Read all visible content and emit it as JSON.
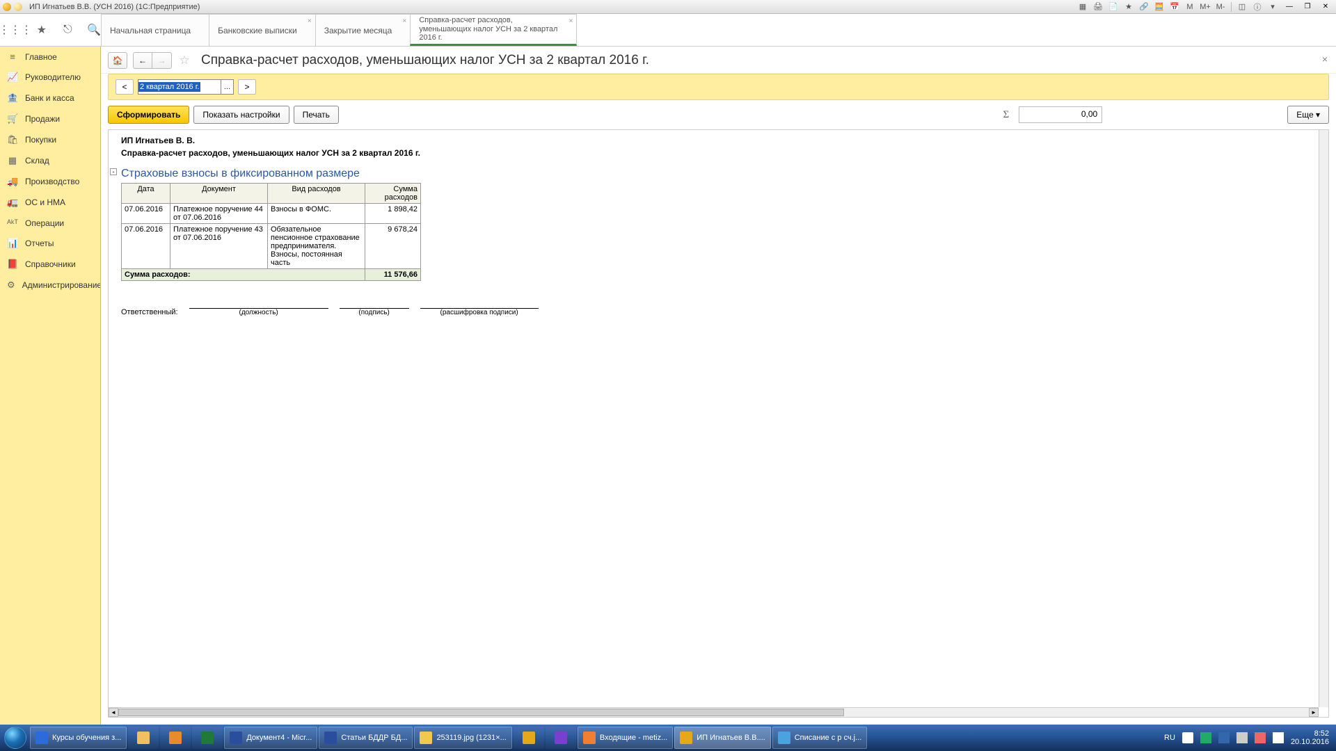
{
  "titlebar": {
    "title": "ИП Игнатьев В.В. (УСН 2016)  (1С:Предприятие)",
    "m_labels": [
      "M",
      "M+",
      "M-"
    ]
  },
  "tabs": [
    {
      "label": "Начальная страница"
    },
    {
      "label": "Банковские выписки"
    },
    {
      "label": "Закрытие месяца"
    },
    {
      "label": "Справка-расчет расходов, уменьшающих налог УСН  за 2 квартал 2016 г.",
      "active": true
    }
  ],
  "sidebar": {
    "items": [
      {
        "icon": "≡",
        "label": "Главное"
      },
      {
        "icon": "📈",
        "label": "Руководителю"
      },
      {
        "icon": "🏦",
        "label": "Банк и касса"
      },
      {
        "icon": "🛒",
        "label": "Продажи"
      },
      {
        "icon": "🛍",
        "label": "Покупки"
      },
      {
        "icon": "▦",
        "label": "Склад"
      },
      {
        "icon": "🚚",
        "label": "Производство"
      },
      {
        "icon": "🚛",
        "label": "ОС и НМА"
      },
      {
        "icon": "ᴬᵏᵀ",
        "label": "Операции"
      },
      {
        "icon": "📊",
        "label": "Отчеты"
      },
      {
        "icon": "📕",
        "label": "Справочники"
      },
      {
        "icon": "⚙",
        "label": "Администрирование"
      }
    ]
  },
  "header": {
    "title": "Справка-расчет расходов, уменьшающих налог УСН  за 2 квартал 2016 г."
  },
  "period": {
    "value": "2 квартал 2016 г.",
    "prev": "<",
    "next": ">"
  },
  "toolbar": {
    "generate": "Сформировать",
    "settings": "Показать настройки",
    "print": "Печать",
    "sum_label": "Σ",
    "sum_value": "0,00",
    "more": "Еще ▾"
  },
  "report": {
    "org": "ИП Игнатьев В. В.",
    "title": "Справка-расчет расходов, уменьшающих налог УСН  за 2 квартал 2016 г.",
    "section": "Страховые взносы в фиксированном размере",
    "columns": [
      "Дата",
      "Документ",
      "Вид расходов",
      "Сумма расходов"
    ],
    "rows": [
      {
        "date": "07.06.2016",
        "doc": "Платежное поручение 44 от 07.06.2016",
        "type": "Взносы в ФОМС.",
        "sum": "1 898,42"
      },
      {
        "date": "07.06.2016",
        "doc": "Платежное поручение 43 от 07.06.2016",
        "type": "Обязательное пенсионное страхование предпринимателя. Взносы, постоянная часть",
        "sum": "9 678,24"
      }
    ],
    "total_label": "Сумма расходов:",
    "total_sum": "11 576,66",
    "responsible": "Ответственный:",
    "sig1": "(должность)",
    "sig2": "(подпись)",
    "sig3": "(расшифровка подписи)"
  },
  "taskbar": {
    "running": [
      {
        "label": "Курсы обучения з...",
        "bg": "#2b6dd8"
      },
      {
        "label": "",
        "bg": "#f0c060",
        "pinned": true
      },
      {
        "label": "",
        "bg": "#e88b2b",
        "pinned": true
      },
      {
        "label": "",
        "bg": "#1f7a3a",
        "pinned": true
      },
      {
        "label": "Документ4 - Micr...",
        "bg": "#2a4e9e"
      },
      {
        "label": "Статьи БДДР БД...",
        "bg": "#2a4e9e"
      },
      {
        "label": "253119.jpg (1231×...",
        "bg": "#f2c94c"
      },
      {
        "label": "",
        "bg": "#e6a817",
        "pinned": true
      },
      {
        "label": "",
        "bg": "#7b3fcf",
        "pinned": true
      },
      {
        "label": "Входящие - metiz...",
        "bg": "#f08030"
      },
      {
        "label": "ИП Игнатьев В.В....",
        "bg": "#e6a817",
        "active": true
      },
      {
        "label": "Списание с р сч.j...",
        "bg": "#4aa3df"
      }
    ],
    "lang": "RU",
    "time": "8:52",
    "date": "20.10.2016"
  }
}
